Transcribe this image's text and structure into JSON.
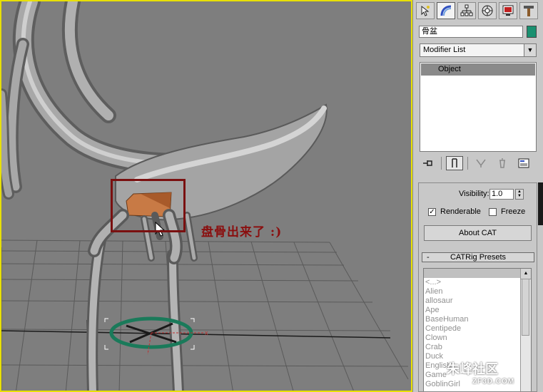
{
  "viewport": {
    "annotation": "盘骨出来了 :)"
  },
  "panel": {
    "tabs": [
      {
        "name": "create-tab",
        "icon": "pointer-star-icon"
      },
      {
        "name": "modify-tab",
        "icon": "modify-arc-icon"
      },
      {
        "name": "hierarchy-tab",
        "icon": "hierarchy-icon"
      },
      {
        "name": "motion-tab",
        "icon": "motion-wheel-icon"
      },
      {
        "name": "display-tab",
        "icon": "display-monitor-icon"
      },
      {
        "name": "utilities-tab",
        "icon": "hammer-icon"
      }
    ],
    "object_name": "骨盆",
    "object_color": "#1a9070",
    "modifier_list": "Modifier List",
    "stack_items": [
      "Object"
    ],
    "visibility_label": "Visibility:",
    "visibility_value": "1.0",
    "renderable_label": "Renderable",
    "renderable_checked": true,
    "freeze_label": "Freeze",
    "freeze_checked": false,
    "about_button": "About CAT",
    "presets_minus": "-",
    "presets_title": "CATRig Presets",
    "presets": [
      "<...>",
      "Alien",
      "allosaur",
      "Ape",
      "BaseHuman",
      "Centipede",
      "Clown",
      "Crab",
      "Duck",
      "English",
      "Game",
      "GoblinGirl"
    ]
  },
  "watermark": {
    "text": "朱峰社区",
    "sub": "ZF3D.COM"
  }
}
